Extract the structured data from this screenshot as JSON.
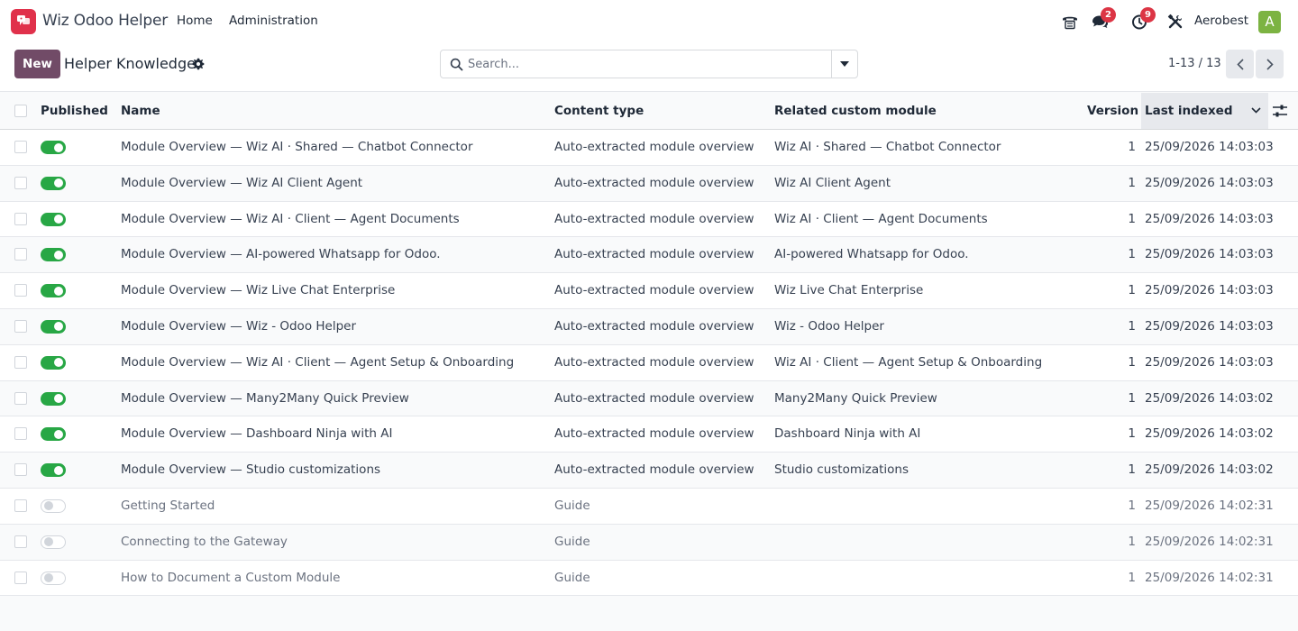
{
  "navbar": {
    "app_name": "Wiz Odoo Helper",
    "menu": [
      "Home",
      "Administration"
    ],
    "messages_badge": "2",
    "activities_badge": "9",
    "company": "Aerobest",
    "avatar_letter": "A",
    "icons": [
      "phone-icon",
      "chat-icon",
      "clock-icon",
      "debug-tools-icon"
    ]
  },
  "control_panel": {
    "new_label": "New",
    "breadcrumb": "Helper Knowledge",
    "search_placeholder": "Search...",
    "pager": "1-13 / 13"
  },
  "columns": {
    "published": "Published",
    "name": "Name",
    "content_type": "Content type",
    "module": "Related custom module",
    "version": "Version",
    "last_indexed": "Last indexed"
  },
  "colors": {
    "brand": "#714b67",
    "toggle_on": "#28a745",
    "badge": "#dc3545",
    "logo": "#e0314b",
    "avatar": "#7cb342"
  },
  "rows": [
    {
      "published": true,
      "name": "Module Overview — Wiz AI · Shared — Chatbot Connector",
      "type": "Auto-extracted module overview",
      "module": "Wiz AI · Shared — Chatbot Connector",
      "version": "1",
      "indexed": "25/09/2026 14:03:03"
    },
    {
      "published": true,
      "name": "Module Overview — Wiz AI Client Agent",
      "type": "Auto-extracted module overview",
      "module": "Wiz AI Client Agent",
      "version": "1",
      "indexed": "25/09/2026 14:03:03"
    },
    {
      "published": true,
      "name": "Module Overview — Wiz AI · Client — Agent Documents",
      "type": "Auto-extracted module overview",
      "module": "Wiz AI · Client — Agent Documents",
      "version": "1",
      "indexed": "25/09/2026 14:03:03"
    },
    {
      "published": true,
      "name": "Module Overview — AI-powered Whatsapp for Odoo.",
      "type": "Auto-extracted module overview",
      "module": "AI-powered Whatsapp for Odoo.",
      "version": "1",
      "indexed": "25/09/2026 14:03:03"
    },
    {
      "published": true,
      "name": "Module Overview — Wiz Live Chat Enterprise",
      "type": "Auto-extracted module overview",
      "module": "Wiz Live Chat Enterprise",
      "version": "1",
      "indexed": "25/09/2026 14:03:03"
    },
    {
      "published": true,
      "name": "Module Overview — Wiz - Odoo Helper",
      "type": "Auto-extracted module overview",
      "module": "Wiz - Odoo Helper",
      "version": "1",
      "indexed": "25/09/2026 14:03:03"
    },
    {
      "published": true,
      "name": "Module Overview — Wiz AI · Client — Agent Setup & Onboarding",
      "type": "Auto-extracted module overview",
      "module": "Wiz AI · Client — Agent Setup & Onboarding",
      "version": "1",
      "indexed": "25/09/2026 14:03:03"
    },
    {
      "published": true,
      "name": "Module Overview — Many2Many Quick Preview",
      "type": "Auto-extracted module overview",
      "module": "Many2Many Quick Preview",
      "version": "1",
      "indexed": "25/09/2026 14:03:02"
    },
    {
      "published": true,
      "name": "Module Overview — Dashboard Ninja with AI",
      "type": "Auto-extracted module overview",
      "module": "Dashboard Ninja with AI",
      "version": "1",
      "indexed": "25/09/2026 14:03:02"
    },
    {
      "published": true,
      "name": "Module Overview — Studio customizations",
      "type": "Auto-extracted module overview",
      "module": "Studio customizations",
      "version": "1",
      "indexed": "25/09/2026 14:03:02"
    },
    {
      "published": false,
      "name": "Getting Started",
      "type": "Guide",
      "module": "",
      "version": "1",
      "indexed": "25/09/2026 14:02:31"
    },
    {
      "published": false,
      "name": "Connecting to the Gateway",
      "type": "Guide",
      "module": "",
      "version": "1",
      "indexed": "25/09/2026 14:02:31"
    },
    {
      "published": false,
      "name": "How to Document a Custom Module",
      "type": "Guide",
      "module": "",
      "version": "1",
      "indexed": "25/09/2026 14:02:31"
    }
  ]
}
